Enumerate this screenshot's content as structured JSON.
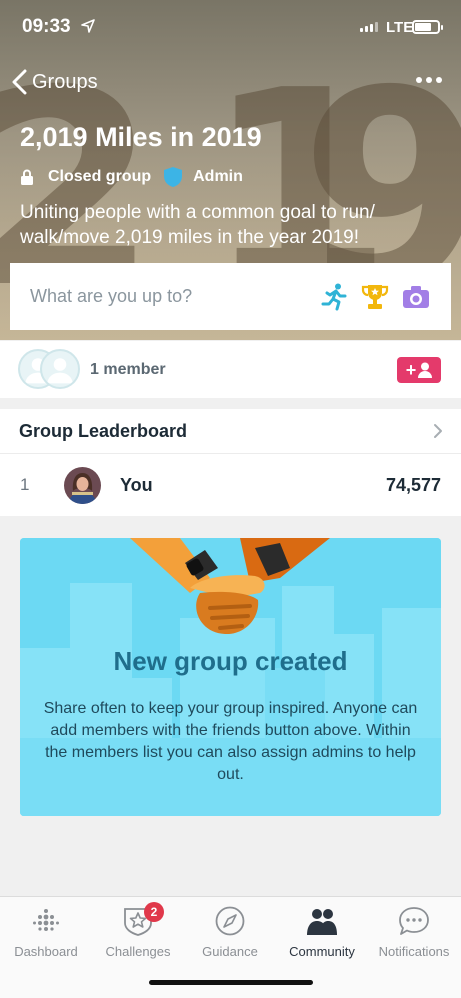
{
  "status_bar": {
    "time": "09:33",
    "network": "LTE"
  },
  "nav": {
    "back_label": "Groups"
  },
  "group": {
    "title": "2,019 Miles in 2019",
    "privacy": "Closed group",
    "role": "Admin",
    "description": "Uniting people with a common goal to run/ walk/move 2,019 miles in the year 2019!",
    "hero_numbers": [
      "2",
      "1",
      "9"
    ]
  },
  "composer": {
    "placeholder": "What are you up to?"
  },
  "members": {
    "count_label": "1 member",
    "add_label": "+"
  },
  "leaderboard": {
    "title": "Group Leaderboard",
    "rows": [
      {
        "rank": "1",
        "name": "You",
        "value": "74,577"
      }
    ]
  },
  "info_card": {
    "title": "New group created",
    "text": "Share often to keep your group inspired. Anyone can add members with the friends button above. Within the members list you can also assign admins to help out."
  },
  "tabbar": {
    "tabs": [
      {
        "label": "Dashboard",
        "icon": "dots-grid-icon"
      },
      {
        "label": "Challenges",
        "icon": "star-shield-icon",
        "badge": "2"
      },
      {
        "label": "Guidance",
        "icon": "compass-icon"
      },
      {
        "label": "Community",
        "icon": "people-icon",
        "active": true
      },
      {
        "label": "Notifications",
        "icon": "chat-bubble-icon"
      }
    ]
  },
  "colors": {
    "accent_pink": "#e43a6b",
    "card_blue": "#6cd9f3",
    "card_title": "#1f6e8c",
    "badge_red": "#e0384a",
    "admin_shield": "#3cb4e6"
  }
}
